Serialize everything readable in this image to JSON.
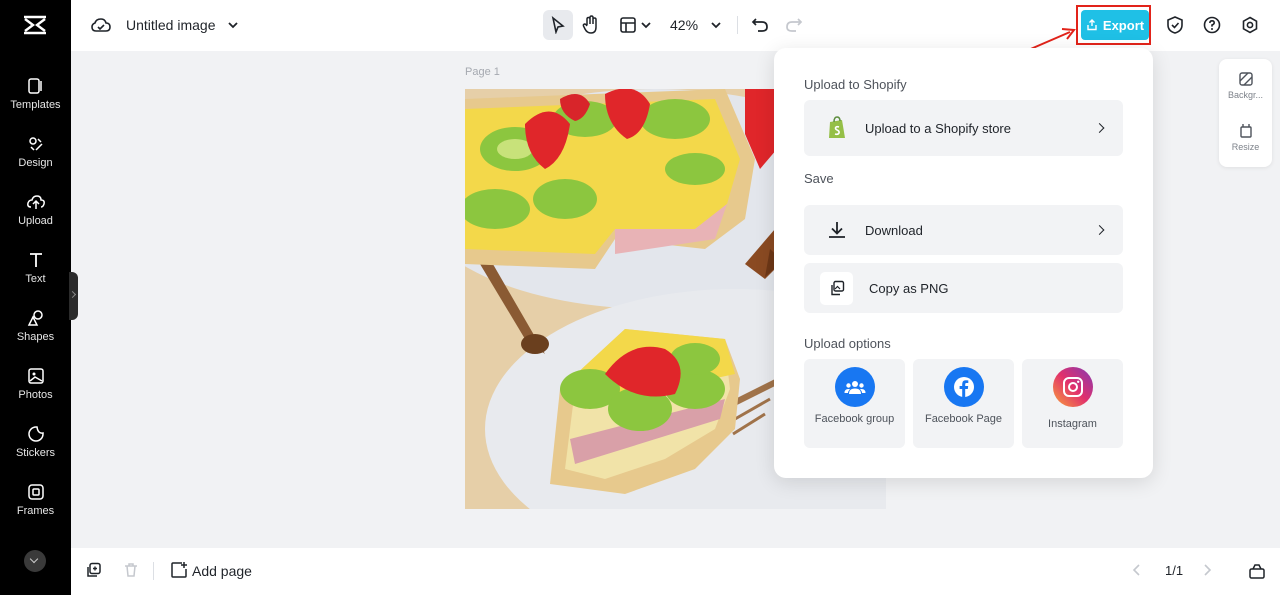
{
  "sidebar": {
    "items": [
      {
        "label": "Templates",
        "icon": "templates-icon"
      },
      {
        "label": "Design",
        "icon": "design-icon"
      },
      {
        "label": "Upload",
        "icon": "upload-icon"
      },
      {
        "label": "Text",
        "icon": "text-icon"
      },
      {
        "label": "Shapes",
        "icon": "shapes-icon"
      },
      {
        "label": "Photos",
        "icon": "photos-icon"
      },
      {
        "label": "Stickers",
        "icon": "stickers-icon"
      },
      {
        "label": "Frames",
        "icon": "frames-icon"
      }
    ]
  },
  "header": {
    "title": "Untitled image",
    "zoom": "42%",
    "export_label": "Export"
  },
  "canvas": {
    "page_label": "Page 1"
  },
  "right_panel": {
    "background_label": "Backgr...",
    "resize_label": "Resize"
  },
  "footer": {
    "add_page_label": "Add page",
    "page_counter": "1/1"
  },
  "export_menu": {
    "shopify_section": "Upload to Shopify",
    "shopify_item": "Upload to a Shopify store",
    "save_section": "Save",
    "download_label": "Download",
    "copy_png_label": "Copy as PNG",
    "upload_section": "Upload options",
    "options": [
      {
        "label": "Facebook group",
        "color": "#1877f2"
      },
      {
        "label": "Facebook Page",
        "color": "#1877f2"
      },
      {
        "label": "Instagram",
        "color": "#e1306c"
      }
    ]
  },
  "colors": {
    "export_button": "#1fc0e6",
    "highlight": "#e2231a",
    "rail": "#000000",
    "shopify_green": "#95bf47"
  }
}
